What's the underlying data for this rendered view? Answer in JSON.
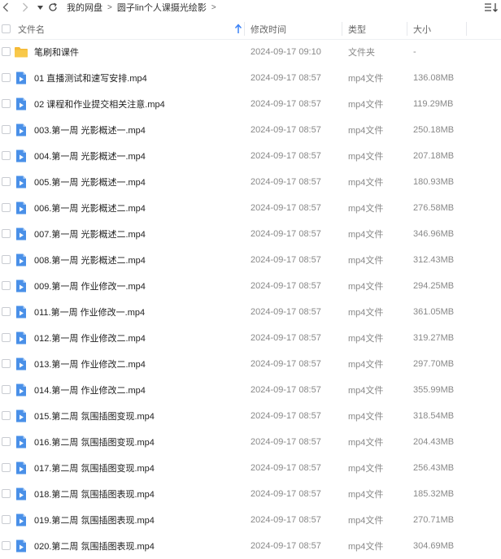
{
  "breadcrumb": [
    "我的网盘",
    "圆子lin个人课摄光绘影"
  ],
  "columns": {
    "name": "文件名",
    "modified": "修改时间",
    "type": "类型",
    "size": "大小"
  },
  "colors": {
    "folder": "#f7c343",
    "video": "#4a90e8",
    "accent": "#3b82f6"
  },
  "files": [
    {
      "icon": "folder-icon",
      "name": "笔刷和课件",
      "modified": "2024-09-17 09:10",
      "type": "文件夹",
      "size": "-"
    },
    {
      "icon": "video-file-icon",
      "name": "01  直播测试和速写安排.mp4",
      "modified": "2024-09-17 08:57",
      "type": "mp4文件",
      "size": "136.08MB"
    },
    {
      "icon": "video-file-icon",
      "name": "02  课程和作业提交相关注意.mp4",
      "modified": "2024-09-17 08:57",
      "type": "mp4文件",
      "size": "119.29MB"
    },
    {
      "icon": "video-file-icon",
      "name": "003.第一周 光影概述一.mp4",
      "modified": "2024-09-17 08:57",
      "type": "mp4文件",
      "size": "250.18MB"
    },
    {
      "icon": "video-file-icon",
      "name": "004.第一周 光影概述一.mp4",
      "modified": "2024-09-17 08:57",
      "type": "mp4文件",
      "size": "207.18MB"
    },
    {
      "icon": "video-file-icon",
      "name": "005.第一周 光影概述一.mp4",
      "modified": "2024-09-17 08:57",
      "type": "mp4文件",
      "size": "180.93MB"
    },
    {
      "icon": "video-file-icon",
      "name": "006.第一周 光影概述二.mp4",
      "modified": "2024-09-17 08:57",
      "type": "mp4文件",
      "size": "276.58MB"
    },
    {
      "icon": "video-file-icon",
      "name": "007.第一周 光影概述二.mp4",
      "modified": "2024-09-17 08:57",
      "type": "mp4文件",
      "size": "346.96MB"
    },
    {
      "icon": "video-file-icon",
      "name": "008.第一周 光影概述二.mp4",
      "modified": "2024-09-17 08:57",
      "type": "mp4文件",
      "size": "312.43MB"
    },
    {
      "icon": "video-file-icon",
      "name": "009.第一周 作业修改一.mp4",
      "modified": "2024-09-17 08:57",
      "type": "mp4文件",
      "size": "294.25MB"
    },
    {
      "icon": "video-file-icon",
      "name": "011.第一周 作业修改一.mp4",
      "modified": "2024-09-17 08:57",
      "type": "mp4文件",
      "size": "361.05MB"
    },
    {
      "icon": "video-file-icon",
      "name": "012.第一周 作业修改二.mp4",
      "modified": "2024-09-17 08:57",
      "type": "mp4文件",
      "size": "319.27MB"
    },
    {
      "icon": "video-file-icon",
      "name": "013.第一周 作业修改二.mp4",
      "modified": "2024-09-17 08:57",
      "type": "mp4文件",
      "size": "297.70MB"
    },
    {
      "icon": "video-file-icon",
      "name": "014.第一周 作业修改二.mp4",
      "modified": "2024-09-17 08:57",
      "type": "mp4文件",
      "size": "355.99MB"
    },
    {
      "icon": "video-file-icon",
      "name": "015.第二周 氛围插图变现.mp4",
      "modified": "2024-09-17 08:57",
      "type": "mp4文件",
      "size": "318.54MB"
    },
    {
      "icon": "video-file-icon",
      "name": "016.第二周 氛围插图变现.mp4",
      "modified": "2024-09-17 08:57",
      "type": "mp4文件",
      "size": "204.43MB"
    },
    {
      "icon": "video-file-icon",
      "name": "017.第二周 氛围插图变现.mp4",
      "modified": "2024-09-17 08:57",
      "type": "mp4文件",
      "size": "256.43MB"
    },
    {
      "icon": "video-file-icon",
      "name": "018.第二周 氛围插图表现.mp4",
      "modified": "2024-09-17 08:57",
      "type": "mp4文件",
      "size": "185.32MB"
    },
    {
      "icon": "video-file-icon",
      "name": "019.第二周 氛围插图表现.mp4",
      "modified": "2024-09-17 08:57",
      "type": "mp4文件",
      "size": "270.71MB"
    },
    {
      "icon": "video-file-icon",
      "name": "020.第二周 氛围插图表现.mp4",
      "modified": "2024-09-17 08:57",
      "type": "mp4文件",
      "size": "304.69MB"
    }
  ]
}
